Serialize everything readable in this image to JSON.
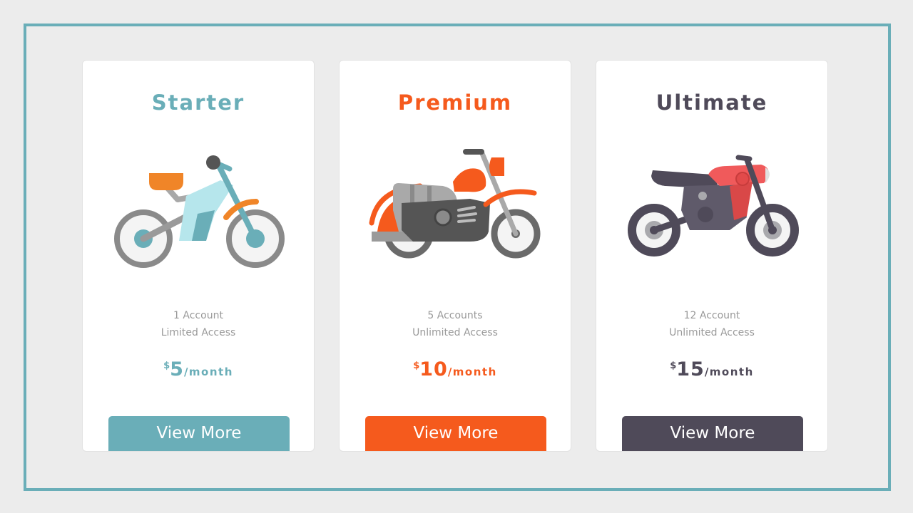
{
  "colors": {
    "frame": "#6aaeb8",
    "background": "#ececec",
    "starter": "#6aaeb8",
    "premium": "#f55a1d",
    "ultimate": "#4f4a59",
    "features_text": "#999999"
  },
  "plans": [
    {
      "name": "Starter",
      "icon": "dirt-bike-icon",
      "features": [
        "1 Account",
        "Limited Access"
      ],
      "currency": "$",
      "price": "5",
      "period": "/month",
      "button_label": "View More"
    },
    {
      "name": "Premium",
      "icon": "cruiser-motorcycle-icon",
      "features": [
        "5 Accounts",
        "Unlimited Access"
      ],
      "currency": "$",
      "price": "10",
      "period": "/month",
      "button_label": "View More"
    },
    {
      "name": "Ultimate",
      "icon": "sport-motorcycle-icon",
      "features": [
        "12 Account",
        "Unlimited Access"
      ],
      "currency": "$",
      "price": "15",
      "period": "/month",
      "button_label": "View More"
    }
  ]
}
